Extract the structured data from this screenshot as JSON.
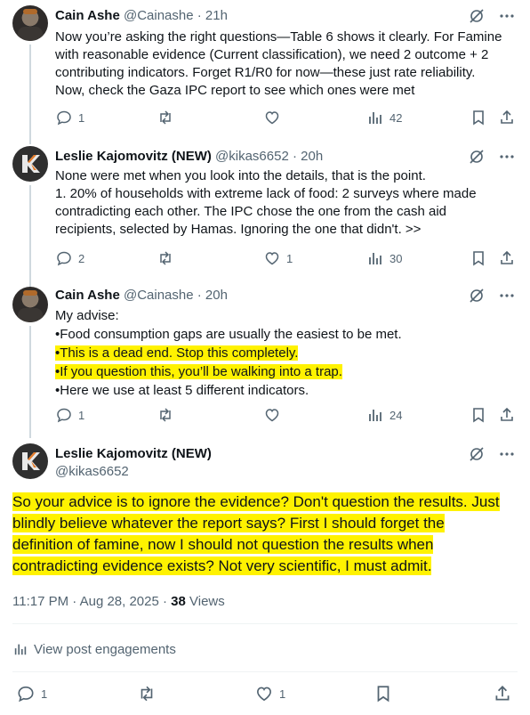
{
  "posts": [
    {
      "author": "Cain Ashe",
      "handle": "@Cainashe",
      "time": "· 21h",
      "lines": [
        "Now you’re asking the right questions—Table 6 shows it clearly. For Famine",
        "with reasonable evidence (Current classification), we need 2 outcome + 2",
        "contributing indicators. Forget R1/R0 for now—these just rate reliability.",
        "Now, check the Gaza IPC report to see which ones were met"
      ],
      "replies": "1",
      "reposts": "",
      "likes": "",
      "views": "42"
    },
    {
      "author": "Leslie Kajomovitz (NEW)",
      "handle": "@kikas6652",
      "time": "· 20h",
      "lines": [
        "None were met when you look into the details, that is the point.",
        "1. 20% of households with extreme lack of food: 2 surveys where made",
        "contradicting each other. The IPC chose the one from the cash aid",
        "recipients, selected by Hamas. Ignoring the one that didn't. >>"
      ],
      "replies": "2",
      "reposts": "",
      "likes": "1",
      "views": "30"
    },
    {
      "author": "Cain Ashe",
      "handle": "@Cainashe",
      "time": "· 20h",
      "lines": [
        "My advise:",
        "•Food consumption gaps are usually the easiest to be met.",
        "•This is a dead end. Stop this completely.",
        "•If you question this, you’ll be walking into a trap.",
        "•Here we use at least 5 different indicators."
      ],
      "replies": "1",
      "reposts": "",
      "likes": "",
      "views": "24"
    }
  ],
  "main_post": {
    "author": "Leslie Kajomovitz (NEW)",
    "handle": "@kikas6652",
    "lines": [
      "So your advice is to ignore the evidence? Don't question the results. Just",
      "blindly believe whatever the report says? First I should forget the",
      "definition of famine, now I should not question the results when",
      "contradicting evidence exists? Not very scientific, I must admit."
    ],
    "time": "11:17 PM · Aug 28, 2025 · ",
    "views_count": "38",
    "views_label": " Views",
    "engagements": "View post engagements",
    "replies": "1",
    "reposts": "",
    "likes": "1"
  },
  "colors": {
    "text": "#0f1419",
    "muted": "#536471",
    "highlight": "#fff200",
    "border": "#eff3f4"
  },
  "icons": [
    "grok-slash-icon",
    "more-icon",
    "reply-icon",
    "repost-icon",
    "like-icon",
    "views-icon",
    "bookmark-icon",
    "share-icon",
    "analytics-icon",
    "k-logo-icon"
  ]
}
